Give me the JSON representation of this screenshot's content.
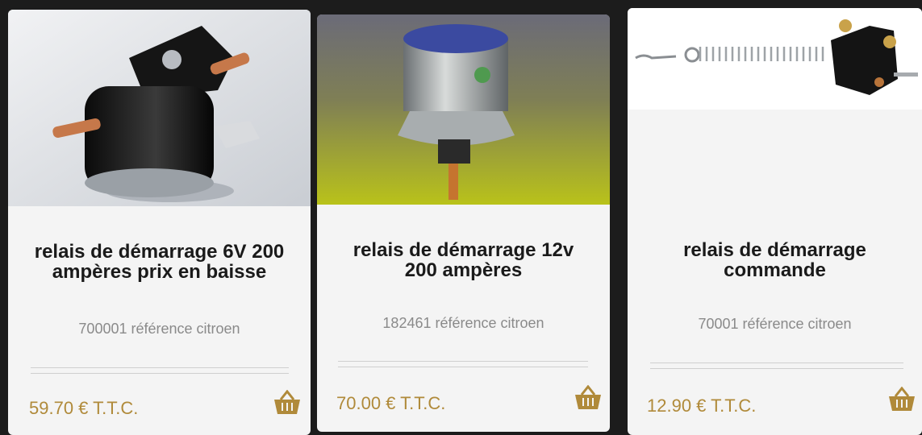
{
  "products": [
    {
      "title_line1": "relais de démarrage 6V 200",
      "title_line2": "ampères prix en baisse",
      "reference": "700001 référence citroen",
      "price": "59.70 € T.T.C.",
      "image_icon": "starter-relay-6v-photo"
    },
    {
      "title_line1": "relais de démarrage 12v",
      "title_line2": "200 ampères",
      "reference": "182461 référence citroen",
      "price": "70.00 € T.T.C.",
      "image_icon": "starter-relay-12v-photo"
    },
    {
      "title_line1": "relais de démarrage",
      "title_line2": "commande",
      "reference": "70001 référence citroen",
      "price": "12.90 € T.T.C.",
      "image_icon": "starter-relay-command-photo"
    }
  ],
  "colors": {
    "price": "#b08a3a",
    "basket": "#b08a3a",
    "card_bg": "#f4f4f4"
  },
  "icons": {
    "basket": "basket-icon"
  }
}
